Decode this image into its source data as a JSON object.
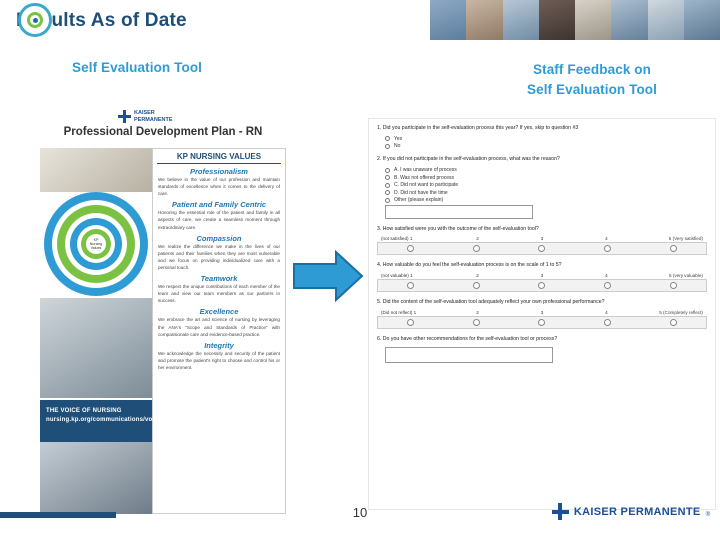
{
  "slide": {
    "title": "Results As of Date",
    "page_number": "10"
  },
  "headings": {
    "left": "Self Evaluation Tool",
    "right": "Staff Feedback on\nSelf Evaluation Tool"
  },
  "brand": {
    "accent_blue": "#2f9bd4",
    "dark_blue": "#1f4e79",
    "green": "#7cc242",
    "kp_blue": "#1b4f9c",
    "logo_text_line1": "KAISER",
    "logo_text_line2": "PERMANENTE",
    "footer_text": "KAISER PERMANENTE",
    "footer_reg": "®"
  },
  "left_doc": {
    "title": "Professional Development Plan - RN",
    "values_header": "KP NURSING VALUES",
    "ribbon_text": "THE VOICE OF NURSING\nnursing.kp.org/communications/voice",
    "circle_center": "KP\nNursing\nValues",
    "values": [
      {
        "name": "Professionalism",
        "text": "We believe in the value of our profession and maintain standards of excellence when it comes to the delivery of care."
      },
      {
        "name": "Patient and Family Centric",
        "text": "Honoring the essential role of the patient and family in all aspects of care, we create a seamless moment through extraordinary care."
      },
      {
        "name": "Compassion",
        "text": "We realize the difference we make in the lives of our patients and their families when they are most vulnerable and we focus on providing individualized care with a personal touch."
      },
      {
        "name": "Teamwork",
        "text": "We respect the unique contributions of each member of the team and view our team members as our partners in success."
      },
      {
        "name": "Excellence",
        "text": "We embrace the art and science of nursing by leveraging the ANA's \"Scope and Standards of Practice\" with compassionate care and evidence-based practice."
      },
      {
        "name": "Integrity",
        "text": "We acknowledge the necessity and security of the patient and promote the patient's right to choose and control his or her environment."
      }
    ]
  },
  "survey": {
    "questions": [
      {
        "number": "1.",
        "text": "Did you participate in the self-evaluation process this year? If yes, skip to question #3",
        "options": [
          "Yes",
          "No"
        ],
        "type": "radio"
      },
      {
        "number": "2.",
        "text": "If you did not participate in the self-evaluation process, what was the reason?",
        "options": [
          "A. I was unaware of process",
          "B. Was not offered process",
          "C. Did not want to participate",
          "D. Did not have the time",
          "Other (please explain)"
        ],
        "type": "radio",
        "has_textbox": true
      },
      {
        "number": "3.",
        "text": "How satisfied were you with the outcome of the self-evaluation tool?",
        "type": "scale",
        "scale_left": "(not satisfied) 1",
        "scale_right": "5 (Very satisfied)",
        "ticks": [
          "2",
          "3",
          "4"
        ]
      },
      {
        "number": "4.",
        "text": "How valuable do you feel the self-evaluation process is on the scale of 1 to 5?",
        "type": "scale",
        "scale_left": "(not valuable) 1",
        "scale_right": "5 (very valuable)",
        "ticks": [
          "2",
          "3",
          "4"
        ]
      },
      {
        "number": "5.",
        "text": "Did the content of the self-evaluation tool adequately reflect your own professional performance?",
        "type": "scale",
        "scale_left": "(Did not reflect) 1",
        "scale_right": "5 (Completely reflect)",
        "ticks": [
          "2",
          "3",
          "4"
        ]
      },
      {
        "number": "6.",
        "text": "Do you have other recommendations for the self-evaluation tool or process?",
        "type": "text"
      }
    ]
  }
}
